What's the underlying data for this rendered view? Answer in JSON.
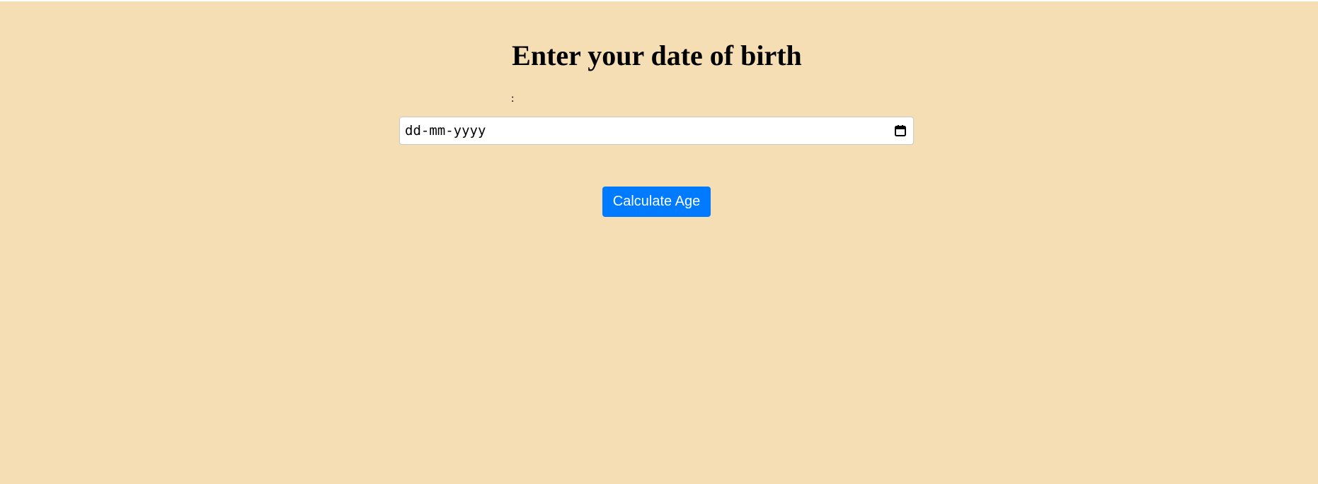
{
  "title": "Enter your date of birth",
  "label": ":",
  "date_input": {
    "placeholder": "dd-mm-yyyy",
    "icon": "calendar-icon"
  },
  "button": {
    "label": "Calculate Age"
  },
  "colors": {
    "background": "#f5deb3",
    "button": "#007bff",
    "button_text": "#ffffff"
  }
}
